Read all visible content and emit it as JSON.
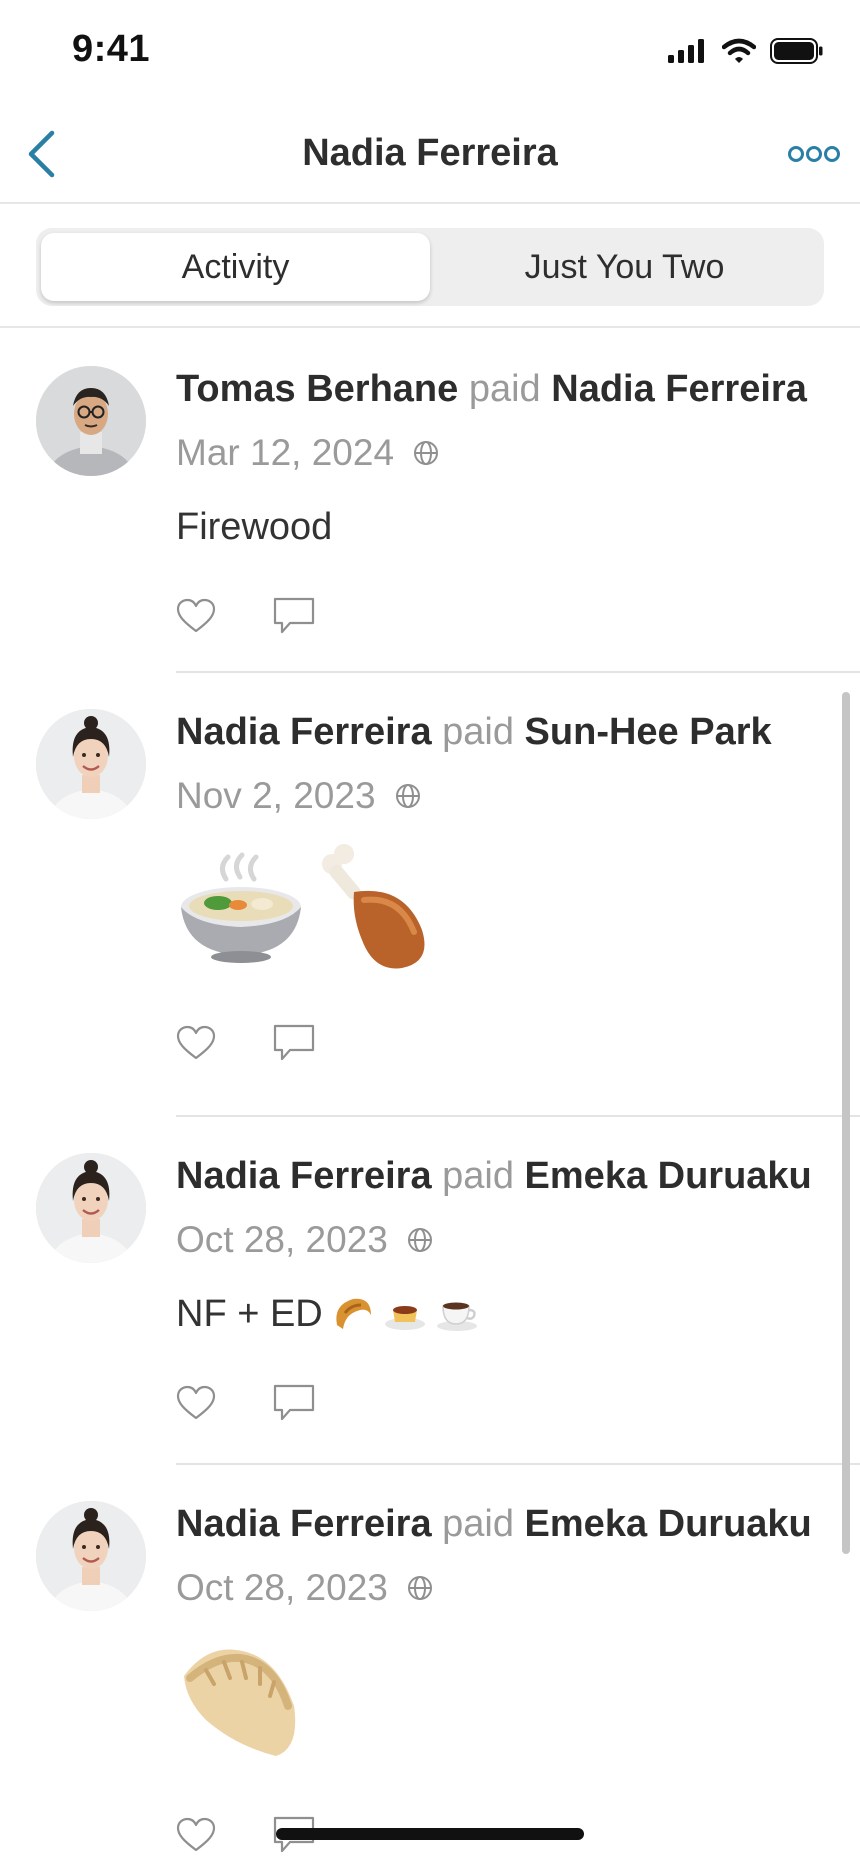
{
  "status_bar": {
    "time": "9:41"
  },
  "nav": {
    "title": "Nadia Ferreira",
    "back_icon": "chevron-left-icon",
    "more_icon": "ellipsis-icon"
  },
  "tabs": [
    {
      "label": "Activity",
      "active": true
    },
    {
      "label": "Just You Two",
      "active": false
    }
  ],
  "feed": [
    {
      "payer": "Tomas Berhane",
      "verb": "paid",
      "payee": "Nadia Ferreira",
      "date": "Mar 12, 2024",
      "visibility_icon": "globe-icon",
      "note": "Firewood",
      "avatar": "man-glasses"
    },
    {
      "payer": "Nadia Ferreira",
      "verb": "paid",
      "payee": "Sun-Hee Park",
      "date": "Nov 2, 2023",
      "visibility_icon": "globe-icon",
      "note_emoji": [
        "stew-bowl",
        "poultry-leg"
      ],
      "avatar": "woman"
    },
    {
      "payer": "Nadia Ferreira",
      "verb": "paid",
      "payee": "Emeka Duruaku",
      "date": "Oct 28, 2023",
      "visibility_icon": "globe-icon",
      "note": "NF + ED",
      "note_emoji_inline": [
        "croissant",
        "custard",
        "coffee"
      ],
      "avatar": "woman"
    },
    {
      "payer": "Nadia Ferreira",
      "verb": "paid",
      "payee": "Emeka Duruaku",
      "date": "Oct 28, 2023",
      "visibility_icon": "globe-icon",
      "note_emoji": [
        "dumpling"
      ],
      "avatar": "woman"
    }
  ],
  "colors": {
    "accent": "#2a7fa6",
    "muted_text": "#9a9a9a",
    "divider": "#e4e4e4"
  }
}
